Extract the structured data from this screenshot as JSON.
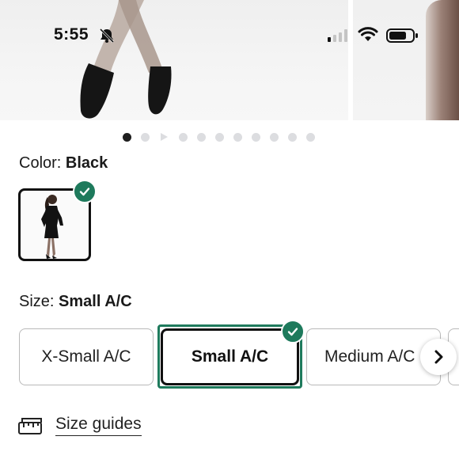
{
  "status_bar": {
    "time": "5:55",
    "icons": [
      "bell-slash-icon",
      "signal-icon",
      "wifi-icon",
      "battery-icon"
    ]
  },
  "gallery": {
    "image_count": 11,
    "active_index": 0,
    "video_marker_index": 2
  },
  "color": {
    "label": "Color:",
    "value": "Black",
    "swatches": [
      {
        "name": "Black",
        "selected": true
      }
    ]
  },
  "size": {
    "label": "Size:",
    "value": "Small A/C",
    "options": [
      {
        "label": "X-Small A/C",
        "selected": false
      },
      {
        "label": "Small A/C",
        "selected": true
      },
      {
        "label": "Medium A/C",
        "selected": false
      }
    ]
  },
  "size_guides": {
    "label": "Size guides",
    "icon": "ruler-icon"
  },
  "colors": {
    "accent": "#1e7a5c",
    "text": "#1a1a1a",
    "border": "#b9b9b9",
    "dot_inactive": "#dcdde0",
    "dot_active": "#1e1e1e"
  }
}
